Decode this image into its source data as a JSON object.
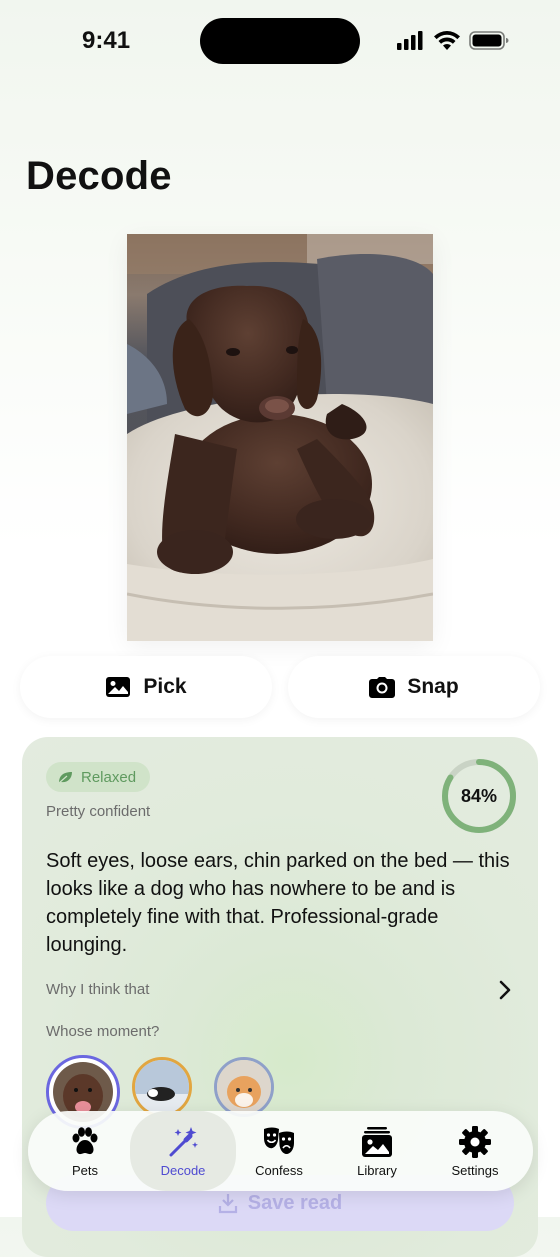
{
  "status_bar": {
    "time": "9:41"
  },
  "page": {
    "title": "Decode"
  },
  "actions": {
    "pick_label": "Pick",
    "snap_label": "Snap"
  },
  "result": {
    "mood": "Relaxed",
    "confidence_label": "Pretty confident",
    "confidence_percent": "84%",
    "confidence_value": 0.84,
    "summary": "Soft eyes, loose ears, chin parked on the bed — this looks like a dog who has nowhere to be and is completely fine with that. Professional-grade lounging.",
    "why_label": "Why I think that",
    "whose_label": "Whose moment?",
    "pets": [
      "chocolate-lab-avatar",
      "black-white-dog-avatar",
      "orange-cat-avatar"
    ],
    "save_label": "Save read"
  },
  "tabbar": {
    "items": [
      {
        "label": "Pets",
        "icon": "paw-icon"
      },
      {
        "label": "Decode",
        "icon": "magic-wand-icon",
        "active": true
      },
      {
        "label": "Confess",
        "icon": "masks-icon"
      },
      {
        "label": "Library",
        "icon": "photo-stack-icon"
      },
      {
        "label": "Settings",
        "icon": "gear-icon"
      }
    ]
  },
  "colors": {
    "accent": "#4f4bd1",
    "mood_green": "#5f9a5f",
    "ring_green": "#7fb27a"
  }
}
